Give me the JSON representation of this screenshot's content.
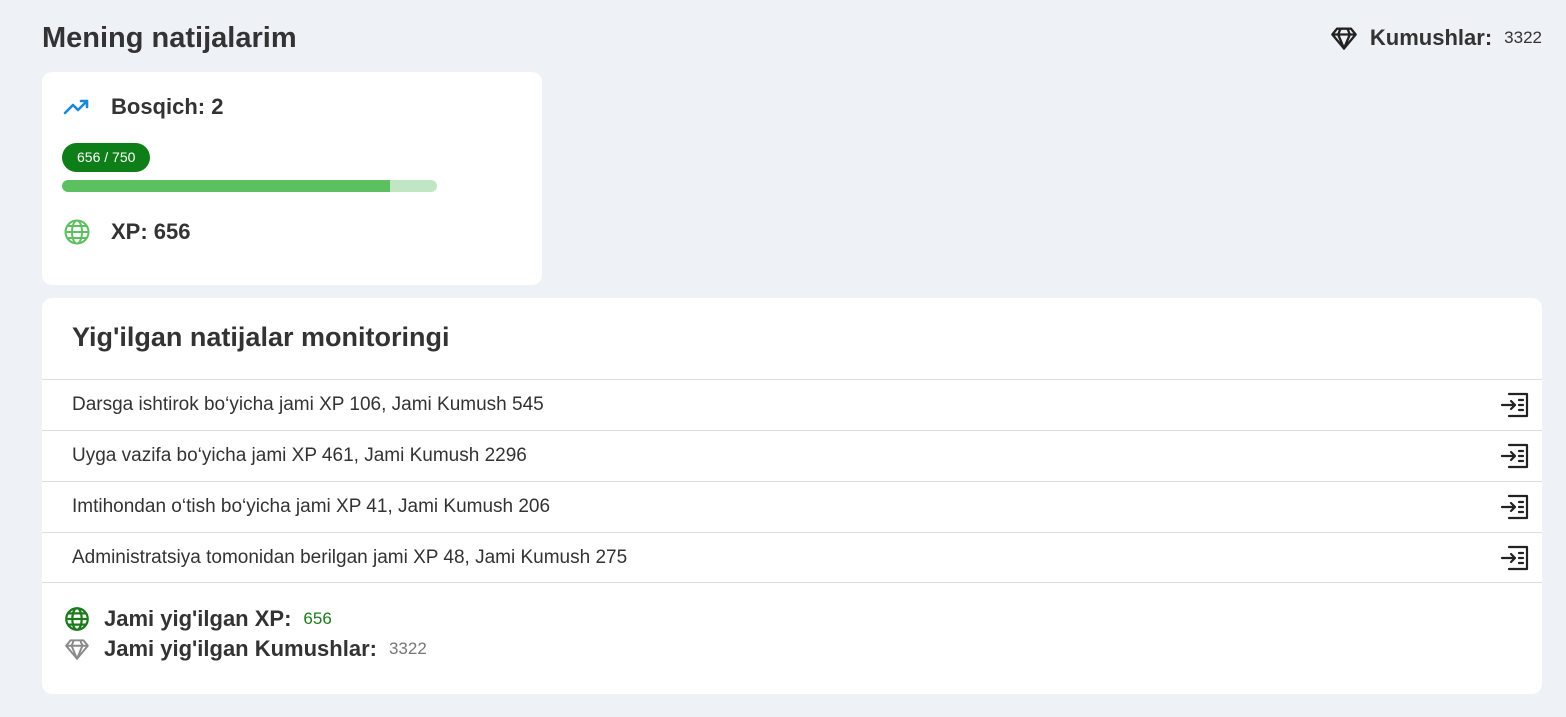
{
  "page_title": "Mening natijalarim",
  "coins": {
    "label": "Kumushlar:",
    "value": "3322",
    "icon": "diamond-icon"
  },
  "level_card": {
    "level_text": "Bosqich: 2",
    "level_icon": "trending-up-icon",
    "progress_text": "656 / 750",
    "progress_current": 656,
    "progress_max": 750,
    "progress_fraction": 0.8747,
    "xp_text": "XP: 656",
    "xp_icon": "globe-icon"
  },
  "monitoring": {
    "title": "Yig'ilgan natijalar monitoringi",
    "rows": [
      {
        "text": "Darsga ishtirok bo‘yicha jami XP 106, Jami Kumush 545"
      },
      {
        "text": "Uyga vazifa bo‘yicha jami XP 461, Jami Kumush 2296"
      },
      {
        "text": "Imtihondan o‘tish bo‘yicha jami XP 41, Jami Kumush 206"
      },
      {
        "text": "Administratsiya tomonidan berilgan jami XP 48, Jami Kumush 275"
      }
    ],
    "row_icon": "open-details-icon",
    "totals": {
      "xp_label": "Jami yig'ilgan XP:",
      "xp_value": "656",
      "coins_label": "Jami yig'ilgan Kumushlar:",
      "coins_value": "3322"
    }
  },
  "colors": {
    "background": "#eef1f6",
    "badge_green": "#0e7e18",
    "progress_fill": "#5cbf60",
    "progress_track": "#c1e6c3",
    "level_icon_blue": "#1a8ad6",
    "globe_green": "#5cbf60",
    "total_green": "#1c7a1c"
  }
}
